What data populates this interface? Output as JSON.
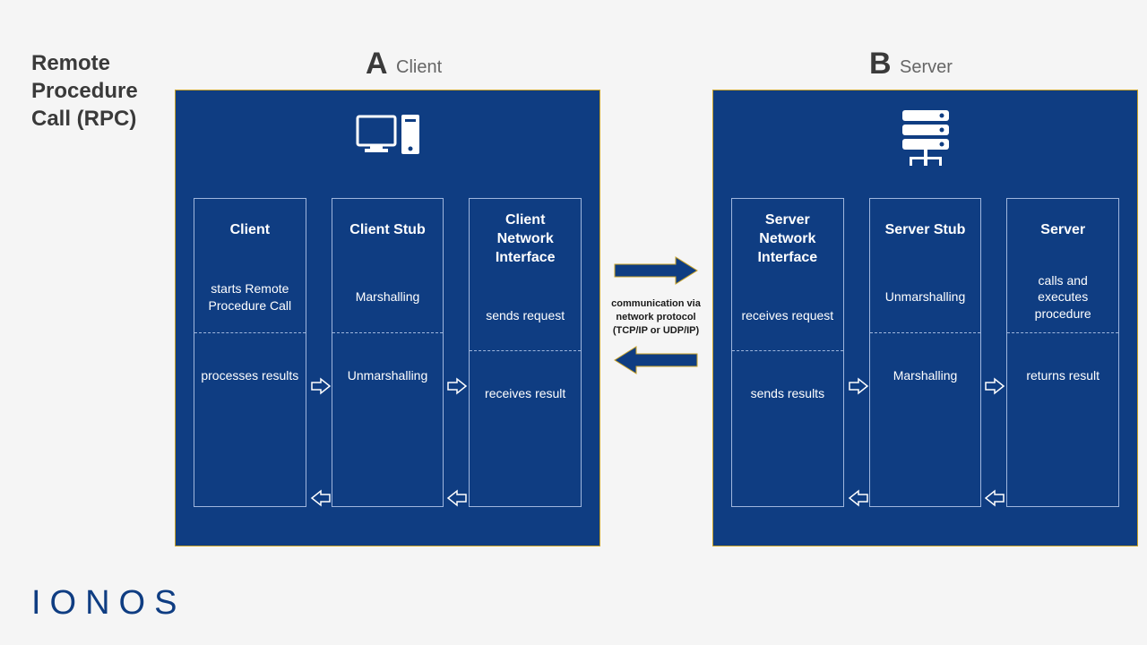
{
  "title": "Remote\nProcedure\nCall (RPC)",
  "letterA": "A",
  "labelA": "Client",
  "letterB": "B",
  "labelB": "Server",
  "client": {
    "cols": [
      {
        "head": "Client",
        "mid": "starts Remote Procedure Call",
        "bot": "processes results"
      },
      {
        "head": "Client Stub",
        "mid": "Marshalling",
        "bot": "Unmarshalling"
      },
      {
        "head": "Client Network Interface",
        "mid": "sends request",
        "bot": "receives result"
      }
    ]
  },
  "server": {
    "cols": [
      {
        "head": "Server Network Interface",
        "mid": "receives request",
        "bot": "sends results"
      },
      {
        "head": "Server Stub",
        "mid": "Unmarshalling",
        "bot": "Marshalling"
      },
      {
        "head": "Server",
        "mid": "calls and executes procedure",
        "bot": "returns result"
      }
    ]
  },
  "midText": "communication via\nnetwork protocol (TCP/IP or UDP/IP)",
  "logo": "IONOS"
}
